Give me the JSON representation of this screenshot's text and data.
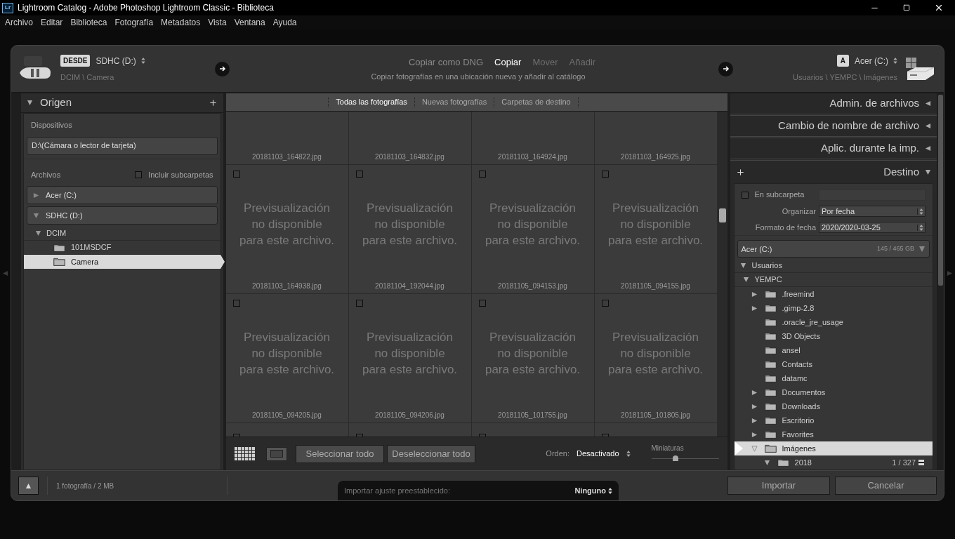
{
  "window": {
    "app_icon": "Lr",
    "title": "Lightroom Catalog - Adobe Photoshop Lightroom Classic - Biblioteca"
  },
  "menu": [
    "Archivo",
    "Editar",
    "Biblioteca",
    "Fotografía",
    "Metadatos",
    "Vista",
    "Ventana",
    "Ayuda"
  ],
  "header": {
    "source": {
      "badge": "DESDE",
      "name": "SDHC (D:)",
      "path": "DCIM \\ Camera"
    },
    "modes": [
      {
        "label": "Copiar como DNG",
        "selected": false,
        "disabled": false
      },
      {
        "label": "Copiar",
        "selected": true,
        "disabled": false
      },
      {
        "label": "Mover",
        "selected": false,
        "disabled": true
      },
      {
        "label": "Añadir",
        "selected": false,
        "disabled": true
      }
    ],
    "mode_description": "Copiar fotografías en una ubicación nueva y añadir al catálogo",
    "destination": {
      "badge": "A",
      "name": "Acer (C:)",
      "path": "Usuarios \\ YEMPC \\ Imágenes"
    }
  },
  "source_panel": {
    "title": "Origen",
    "expanded": true,
    "devices_label": "Dispositivos",
    "device": "D:\\(Cámara o lector de tarjeta)",
    "files_label": "Archivos",
    "include_subfolders": {
      "label": "Incluir subcarpetas",
      "checked": false
    },
    "volumes": [
      {
        "name": "Acer (C:)",
        "expanded": false
      },
      {
        "name": "SDHC (D:)",
        "expanded": true,
        "children": [
          {
            "name": "DCIM",
            "expanded": true,
            "selected": false,
            "children": [
              {
                "name": "101MSDCF",
                "selected": false
              },
              {
                "name": "Camera",
                "selected": true
              }
            ]
          }
        ]
      }
    ]
  },
  "tabs": [
    {
      "label": "Todas las fotografías",
      "selected": true
    },
    {
      "label": "Nuevas fotografías",
      "selected": false
    },
    {
      "label": "Carpetas de destino",
      "selected": false
    }
  ],
  "grid": {
    "cells": [
      {
        "kind": "top-cut",
        "filename": "20181103_164822.jpg"
      },
      {
        "kind": "top-cut",
        "filename": "20181103_164832.jpg"
      },
      {
        "kind": "top-cut",
        "filename": "20181103_164924.jpg"
      },
      {
        "kind": "top-cut",
        "filename": "20181103_164925.jpg"
      },
      {
        "kind": "full",
        "checked": false,
        "preview": "Previsualización no disponible para este archivo.",
        "filename": "20181103_164938.jpg"
      },
      {
        "kind": "full",
        "checked": false,
        "preview": "Previsualización no disponible para este archivo.",
        "filename": "20181104_192044.jpg"
      },
      {
        "kind": "full",
        "checked": false,
        "preview": "Previsualización no disponible para este archivo.",
        "filename": "20181105_094153.jpg"
      },
      {
        "kind": "full",
        "checked": false,
        "preview": "Previsualización no disponible para este archivo.",
        "filename": "20181105_094155.jpg"
      },
      {
        "kind": "full",
        "checked": false,
        "preview": "Previsualización no disponible para este archivo.",
        "filename": "20181105_094205.jpg"
      },
      {
        "kind": "full",
        "checked": false,
        "preview": "Previsualización no disponible para este archivo.",
        "filename": "20181105_094206.jpg"
      },
      {
        "kind": "full",
        "checked": false,
        "preview": "Previsualización no disponible para este archivo.",
        "filename": "20181105_101755.jpg"
      },
      {
        "kind": "full",
        "checked": false,
        "preview": "Previsualización no disponible para este archivo.",
        "filename": "20181105_101805.jpg"
      },
      {
        "kind": "bottom-cut",
        "checked": false
      },
      {
        "kind": "bottom-cut",
        "checked": false
      },
      {
        "kind": "bottom-cut",
        "checked": false
      },
      {
        "kind": "bottom-cut",
        "checked": false
      }
    ]
  },
  "toolbar": {
    "select_all": "Seleccionar todo",
    "deselect_all": "Deseleccionar todo",
    "sort_label": "Orden:",
    "sort_value": "Desactivado",
    "thumbnails_label": "Miniaturas",
    "thumbnails": {
      "level": 0.36
    }
  },
  "right_panels": [
    {
      "title": "Admin. de archivos",
      "expanded": false
    },
    {
      "title": "Cambio de nombre de archivo",
      "expanded": false
    },
    {
      "title": "Aplic. durante la imp.",
      "expanded": false
    },
    {
      "title": "Destino",
      "expanded": true
    }
  ],
  "destination_panel": {
    "subfolder": {
      "label": "En subcarpeta",
      "checked": false
    },
    "organize_label": "Organizar",
    "organize_value": "Por fecha",
    "date_format_label": "Formato de fecha",
    "date_format_value": "2020/2020-03-25",
    "volume": {
      "name": "Acer (C:)",
      "space": "145 / 465 GB"
    },
    "tree": [
      {
        "name": "Usuarios",
        "kind": "group",
        "expanded": true,
        "children": [
          {
            "name": "YEMPC",
            "kind": "group",
            "expanded": true,
            "children": [
              {
                "name": ".freemind",
                "kind": "folder",
                "expandable": true,
                "expanded": false,
                "selected": false
              },
              {
                "name": ".gimp-2.8",
                "kind": "folder",
                "expandable": true,
                "expanded": false,
                "selected": false
              },
              {
                "name": ".oracle_jre_usage",
                "kind": "folder",
                "expandable": false,
                "selected": false
              },
              {
                "name": "3D Objects",
                "kind": "folder",
                "expandable": false,
                "selected": false
              },
              {
                "name": "ansel",
                "kind": "folder",
                "expandable": false,
                "selected": false
              },
              {
                "name": "Contacts",
                "kind": "folder",
                "expandable": false,
                "selected": false
              },
              {
                "name": "datamc",
                "kind": "folder",
                "expandable": false,
                "selected": false
              },
              {
                "name": "Documentos",
                "kind": "folder",
                "expandable": true,
                "expanded": false,
                "selected": false
              },
              {
                "name": "Downloads",
                "kind": "folder",
                "expandable": true,
                "expanded": false,
                "selected": false
              },
              {
                "name": "Escritorio",
                "kind": "folder",
                "expandable": true,
                "expanded": false,
                "selected": false
              },
              {
                "name": "Favorites",
                "kind": "folder",
                "expandable": true,
                "expanded": false,
                "selected": false
              },
              {
                "name": "Imágenes",
                "kind": "folder",
                "expandable": true,
                "expanded": true,
                "selected": true,
                "children": [
                  {
                    "name": "2018",
                    "kind": "folder",
                    "expandable": true,
                    "expanded": true,
                    "selected": false,
                    "count": "1 / 327"
                  }
                ]
              }
            ]
          }
        ]
      }
    ]
  },
  "footer": {
    "summary": "1 fotografía / 2 MB",
    "preset_label": "Importar ajuste preestablecido:",
    "preset_value": "Ninguno",
    "import": "Importar",
    "cancel": "Cancelar"
  }
}
